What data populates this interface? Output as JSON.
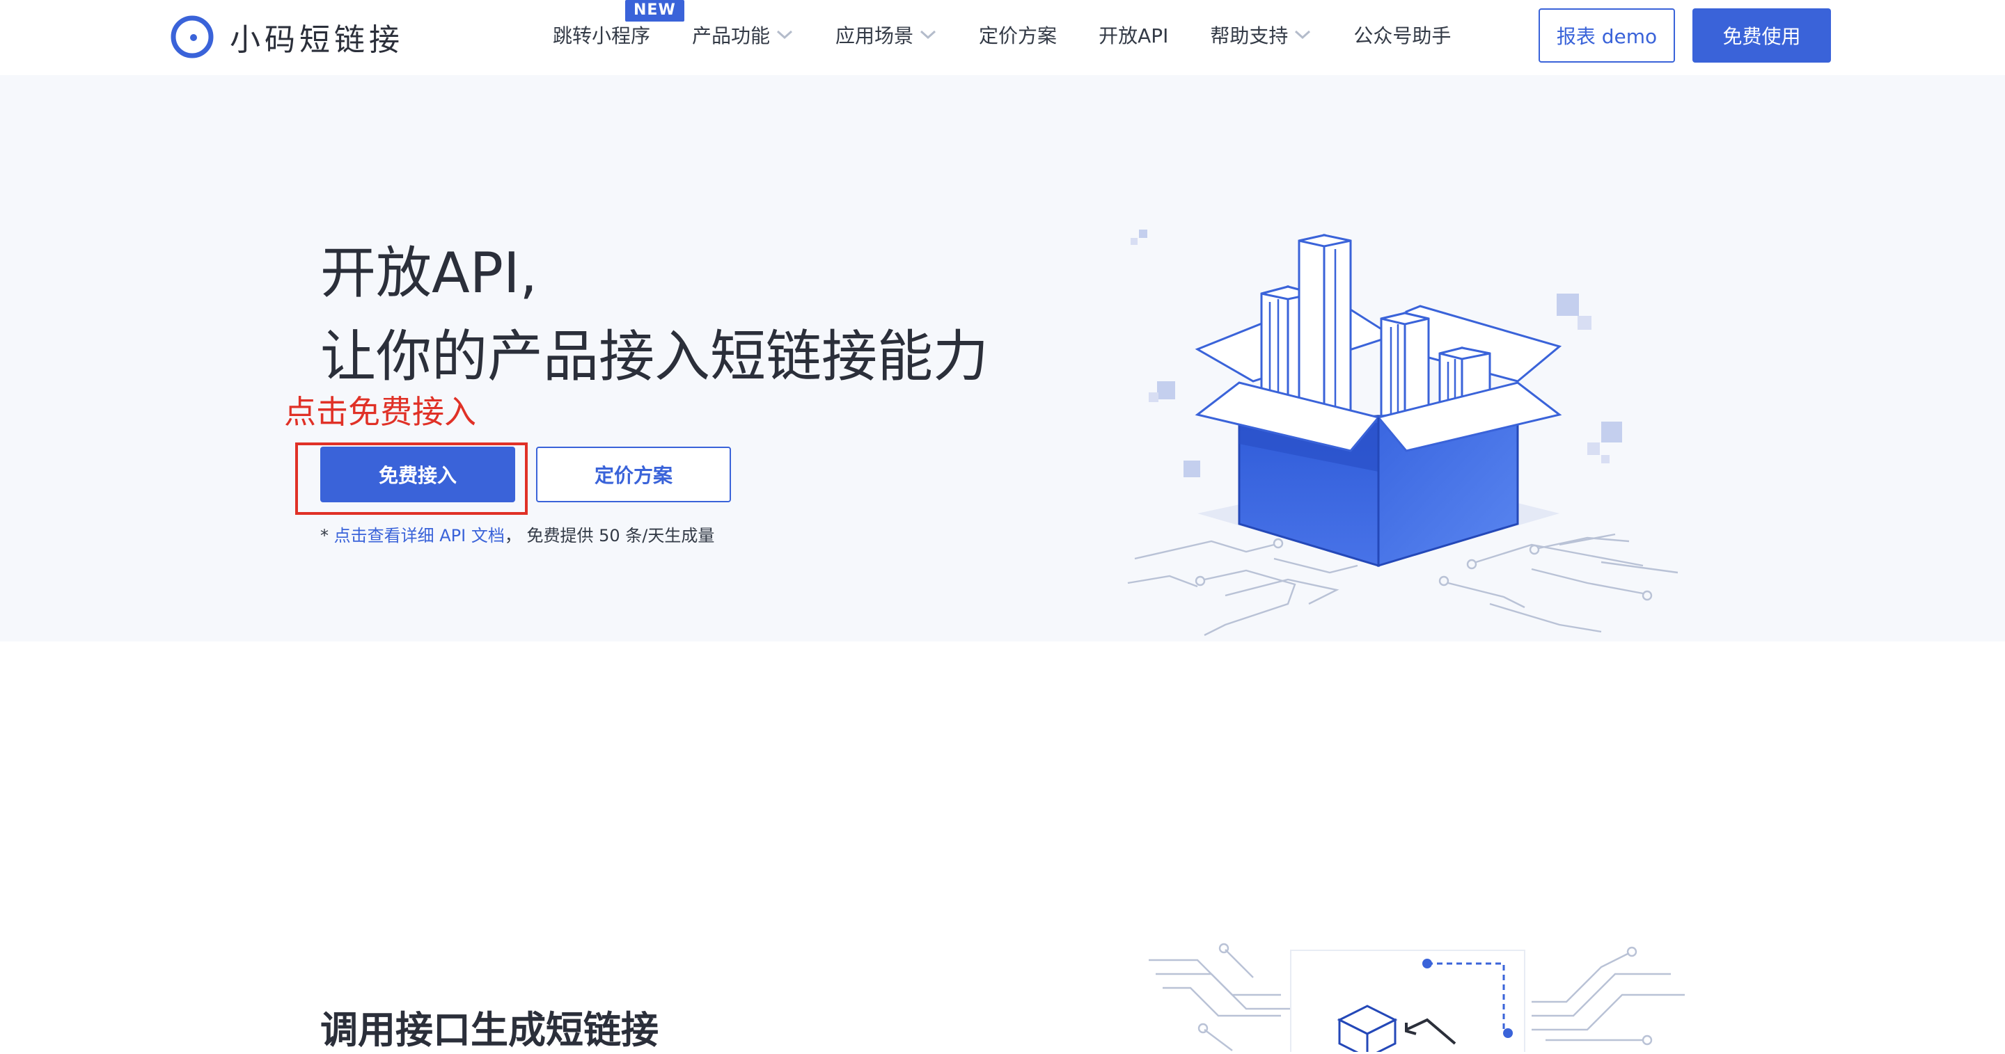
{
  "brand": {
    "name": "小码短链接",
    "accent": "#3a63d9",
    "annotation_color": "#e03127"
  },
  "nav": {
    "items": [
      {
        "label": "跳转小程序",
        "badge": "NEW",
        "has_dropdown": false
      },
      {
        "label": "产品功能",
        "has_dropdown": true
      },
      {
        "label": "应用场景",
        "has_dropdown": true
      },
      {
        "label": "定价方案",
        "has_dropdown": false
      },
      {
        "label": "开放API",
        "has_dropdown": false
      },
      {
        "label": "帮助支持",
        "has_dropdown": true
      },
      {
        "label": "公众号助手",
        "has_dropdown": false
      }
    ],
    "demo_button": "报表 demo",
    "free_use_button": "免费使用"
  },
  "hero": {
    "title_line1": "开放API,",
    "title_line2": "让你的产品接入短链接能力",
    "annotation": "点击免费接入",
    "primary_button": "免费接入",
    "secondary_button": "定价方案",
    "note_prefix": "* ",
    "note_link": "点击查看详细 API 文档",
    "note_separator": "，",
    "note_text": "免费提供 50 条/天生成量"
  },
  "section2": {
    "title": "调用接口生成短链接"
  },
  "icons": [
    "logo-icon",
    "chevron-down-icon",
    "open-box-illustration",
    "circuit-illustration"
  ]
}
